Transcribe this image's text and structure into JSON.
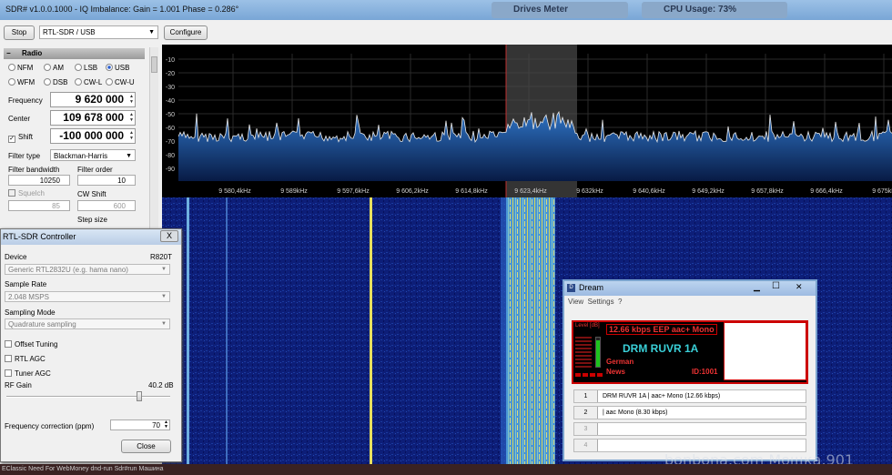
{
  "window": {
    "title": "SDR# v1.0.0.1000 - IQ Imbalance: Gain = 1.001 Phase = 0.286°",
    "bg_task1": "Drives Meter",
    "bg_task2": "CPU Usage: 73%"
  },
  "toolbar": {
    "stop_label": "Stop",
    "source_value": "RTL-SDR / USB",
    "configure_label": "Configure"
  },
  "radio": {
    "header": "Radio",
    "modes": [
      {
        "label": "NFM",
        "selected": false
      },
      {
        "label": "AM",
        "selected": false
      },
      {
        "label": "LSB",
        "selected": false
      },
      {
        "label": "USB",
        "selected": true
      },
      {
        "label": "WFM",
        "selected": false
      },
      {
        "label": "DSB",
        "selected": false
      },
      {
        "label": "CW-L",
        "selected": false
      },
      {
        "label": "CW-U",
        "selected": false
      }
    ],
    "frequency_label": "Frequency",
    "frequency_value": "9 620 000",
    "center_label": "Center",
    "center_value": "109 678 000",
    "shift_label": "Shift",
    "shift_value": "-100 000 000",
    "filter_type_label": "Filter type",
    "filter_type_value": "Blackman-Harris",
    "filter_bw_label": "Filter bandwidth",
    "filter_bw_value": "10250",
    "filter_order_label": "Filter order",
    "filter_order_value": "10",
    "squelch_label": "Squelch",
    "squelch_value": "85",
    "cw_shift_label": "CW Shift",
    "cw_shift_value": "600",
    "step_size_label": "Step size"
  },
  "spectrum": {
    "y_labels": [
      "-10",
      "-20",
      "-30",
      "-40",
      "-50",
      "-60",
      "-70",
      "-80",
      "-90"
    ],
    "x_labels": [
      "9 580,4kHz",
      "9 589kHz",
      "9 597,6kHz",
      "9 606,2kHz",
      "9 614,8kHz",
      "9 623,4kHz",
      "9 632kHz",
      "9 640,6kHz",
      "9 649,2kHz",
      "9 657,8kHz",
      "9 666,4kHz",
      "9 675kHz"
    ]
  },
  "rtl_controller": {
    "title": "RTL-SDR Controller",
    "close_x": "X",
    "device_label": "Device",
    "device_tuner": "R820T",
    "device_value": "Generic RTL2832U (e.g. hama nano)",
    "sample_rate_label": "Sample Rate",
    "sample_rate_value": "2.048 MSPS",
    "sampling_mode_label": "Sampling Mode",
    "sampling_mode_value": "Quadrature sampling",
    "offset_tuning_label": "Offset Tuning",
    "rtl_agc_label": "RTL AGC",
    "tuner_agc_label": "Tuner AGC",
    "rf_gain_label": "RF Gain",
    "rf_gain_value": "40.2 dB",
    "rf_gain_level": 0.82,
    "freq_corr_label": "Frequency correction (ppm)",
    "freq_corr_value": "70",
    "close_label": "Close"
  },
  "dream": {
    "title": "Dream",
    "menu": [
      "View",
      "Settings",
      "?"
    ],
    "level_label": "Level [dB]",
    "bitrate": "12.66 kbps EEP aac+ Mono",
    "station": "DRM RUVR 1A",
    "language": "German",
    "program_type": "News",
    "id": "ID:1001",
    "services": [
      {
        "num": "1",
        "text": "DRM RUVR 1A  |   aac+ Mono (12.66 kbps)"
      },
      {
        "num": "2",
        "text": "|   aac Mono (8.30 kbps)"
      },
      {
        "num": "3",
        "text": ""
      },
      {
        "num": "4",
        "text": ""
      }
    ]
  },
  "taskbar": {
    "items": "EClassic    Need For    WebMoney    dnd-run    Sdr#run    Машина"
  },
  "watermark": "bonbona.com  Мощка.901"
}
